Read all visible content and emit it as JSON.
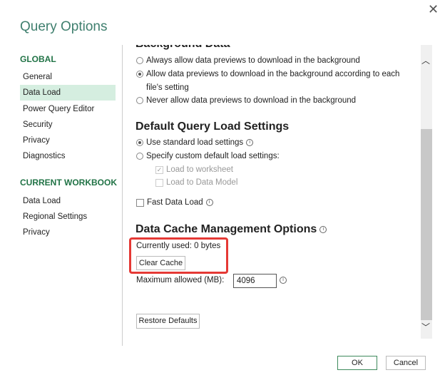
{
  "window": {
    "title": "Query Options",
    "close_icon": "close-icon"
  },
  "sidebar": {
    "global_heading": "GLOBAL",
    "global_items": [
      "General",
      "Data Load",
      "Power Query Editor",
      "Security",
      "Privacy",
      "Diagnostics"
    ],
    "workbook_heading": "CURRENT WORKBOOK",
    "workbook_items": [
      "Data Load",
      "Regional Settings",
      "Privacy"
    ],
    "selected": "Data Load"
  },
  "background": {
    "heading": "Background Data",
    "options": [
      "Always allow data previews to download in the background",
      "Allow data previews to download in the background according to each",
      "file's setting",
      "Never allow data previews to download in the background"
    ],
    "selected_index": 1
  },
  "load": {
    "heading": "Default Query Load Settings",
    "standard": "Use standard load settings",
    "custom": "Specify custom default load settings:",
    "to_worksheet": "Load to worksheet",
    "to_data_model": "Load to Data Model",
    "fast_load": "Fast Data Load",
    "worksheet_checked": true,
    "data_model_checked": false,
    "fast_load_checked": false
  },
  "cache": {
    "heading": "Data Cache Management Options",
    "currently_used": "Currently used: 0 bytes",
    "clear_button": "Clear Cache",
    "max_label": "Maximum allowed (MB):",
    "max_value": "4096",
    "highlight_color": "#e53935"
  },
  "restore_button": "Restore Defaults",
  "footer": {
    "ok": "OK",
    "cancel": "Cancel"
  },
  "colors": {
    "accent": "#217346",
    "selected_bg": "#d5eee0"
  }
}
